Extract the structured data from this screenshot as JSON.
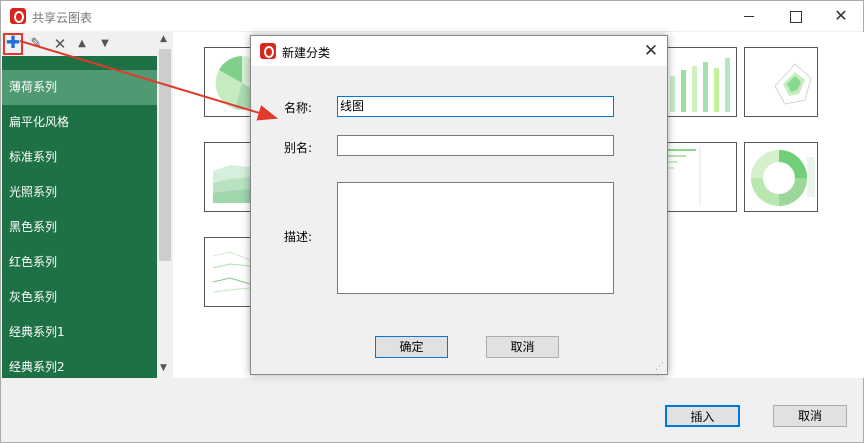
{
  "window": {
    "title": "共享云图表"
  },
  "toolbar": {
    "add_icon": "plus-icon",
    "edit_icon": "edit-icon",
    "delete_icon": "delete-icon",
    "up_icon": "arrow-up-icon",
    "down_icon": "arrow-down-icon",
    "add_glyph": "✚",
    "edit_glyph": "✎",
    "delete_glyph": "✕",
    "up_glyph": "▲",
    "down_glyph": "▼"
  },
  "sidebar": {
    "items": [
      {
        "label": "薄荷系列",
        "selected": true
      },
      {
        "label": "扁平化风格",
        "selected": false
      },
      {
        "label": "标准系列",
        "selected": false
      },
      {
        "label": "光照系列",
        "selected": false
      },
      {
        "label": "黑色系列",
        "selected": false
      },
      {
        "label": "红色系列",
        "selected": false
      },
      {
        "label": "灰色系列",
        "selected": false
      },
      {
        "label": "经典系列1",
        "selected": false
      },
      {
        "label": "经典系列2",
        "selected": false
      }
    ],
    "color": "#1e7145",
    "selected_color": "#4f9a72"
  },
  "footer": {
    "insert_label": "插入",
    "cancel_label": "取消"
  },
  "dialog": {
    "title": "新建分类",
    "name_label": "名称:",
    "name_value": "线图",
    "alias_label": "别名:",
    "alias_value": "",
    "desc_label": "描述:",
    "desc_value": "",
    "ok_label": "确定",
    "cancel_label": "取消",
    "close_glyph": "✕"
  },
  "annotation": {
    "arrow_color": "#e03a2e",
    "highlight_color": "#e03a2e"
  },
  "accent_color": "#0078d7"
}
